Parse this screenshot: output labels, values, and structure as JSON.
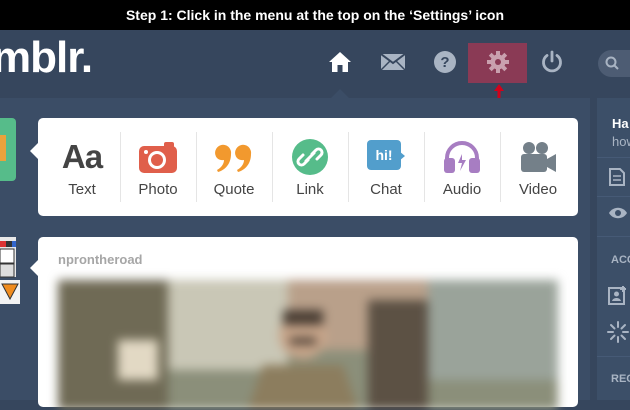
{
  "banner": {
    "text": "Step 1: Click in the menu at the top on the ‘Settings’ icon"
  },
  "logo": {
    "text": "mblr."
  },
  "nav": {
    "icons": [
      "home-icon",
      "mail-icon",
      "help-icon",
      "settings-icon",
      "power-icon",
      "search-icon"
    ],
    "highlight_color": "#8a3a55"
  },
  "post_types": [
    {
      "label": "Text",
      "icon_text": "Aa",
      "color": "#444444"
    },
    {
      "label": "Photo",
      "color": "#e05f4b"
    },
    {
      "label": "Quote",
      "color": "#f2992e"
    },
    {
      "label": "Link",
      "color": "#56bc8a"
    },
    {
      "label": "Chat",
      "icon_text": "hi!",
      "color": "#529ecc"
    },
    {
      "label": "Audio",
      "color": "#a77dc2"
    },
    {
      "label": "Video",
      "color": "#748089"
    }
  ],
  "post": {
    "username": "nprontheroad"
  },
  "right_panel": {
    "name": "Ha",
    "subtitle": "how",
    "section1": "ACC",
    "section2": "REC"
  },
  "colors": {
    "background": "#36465d",
    "accent_red": "#d0021b"
  }
}
